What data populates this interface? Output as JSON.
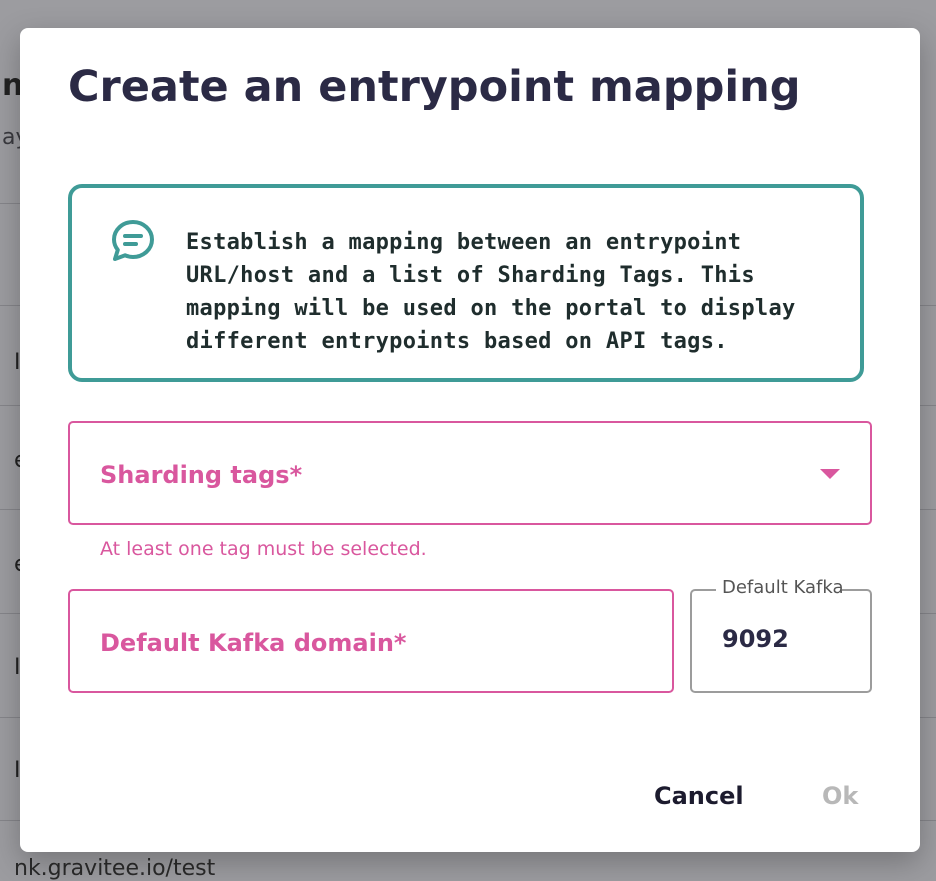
{
  "background": {
    "title_fragment": "n",
    "subtitle_fragment": "ay",
    "row_fragments": [
      "I",
      "e",
      "e",
      "I",
      "I"
    ],
    "bottom_url": "nk.gravitee.io/test"
  },
  "dialog": {
    "title": "Create an entrypoint mapping",
    "info_banner": {
      "icon": "chat-message-icon",
      "text": "Establish a mapping between an entrypoint URL/host and a list of Sharding Tags. This mapping will be used on the portal to display different entrypoints based on API tags."
    },
    "sharding_tags": {
      "label": "Sharding tags*",
      "error": "At least one tag must be selected."
    },
    "kafka_domain": {
      "label": "Default Kafka domain*"
    },
    "kafka_port": {
      "label": "Default Kafka port",
      "value": "9092"
    },
    "actions": {
      "cancel": "Cancel",
      "ok": "Ok"
    }
  },
  "colors": {
    "accent_error": "#d9579e",
    "banner_border": "#3f9b97",
    "title": "#2b2a45",
    "disabled": "#b8b8b8"
  }
}
